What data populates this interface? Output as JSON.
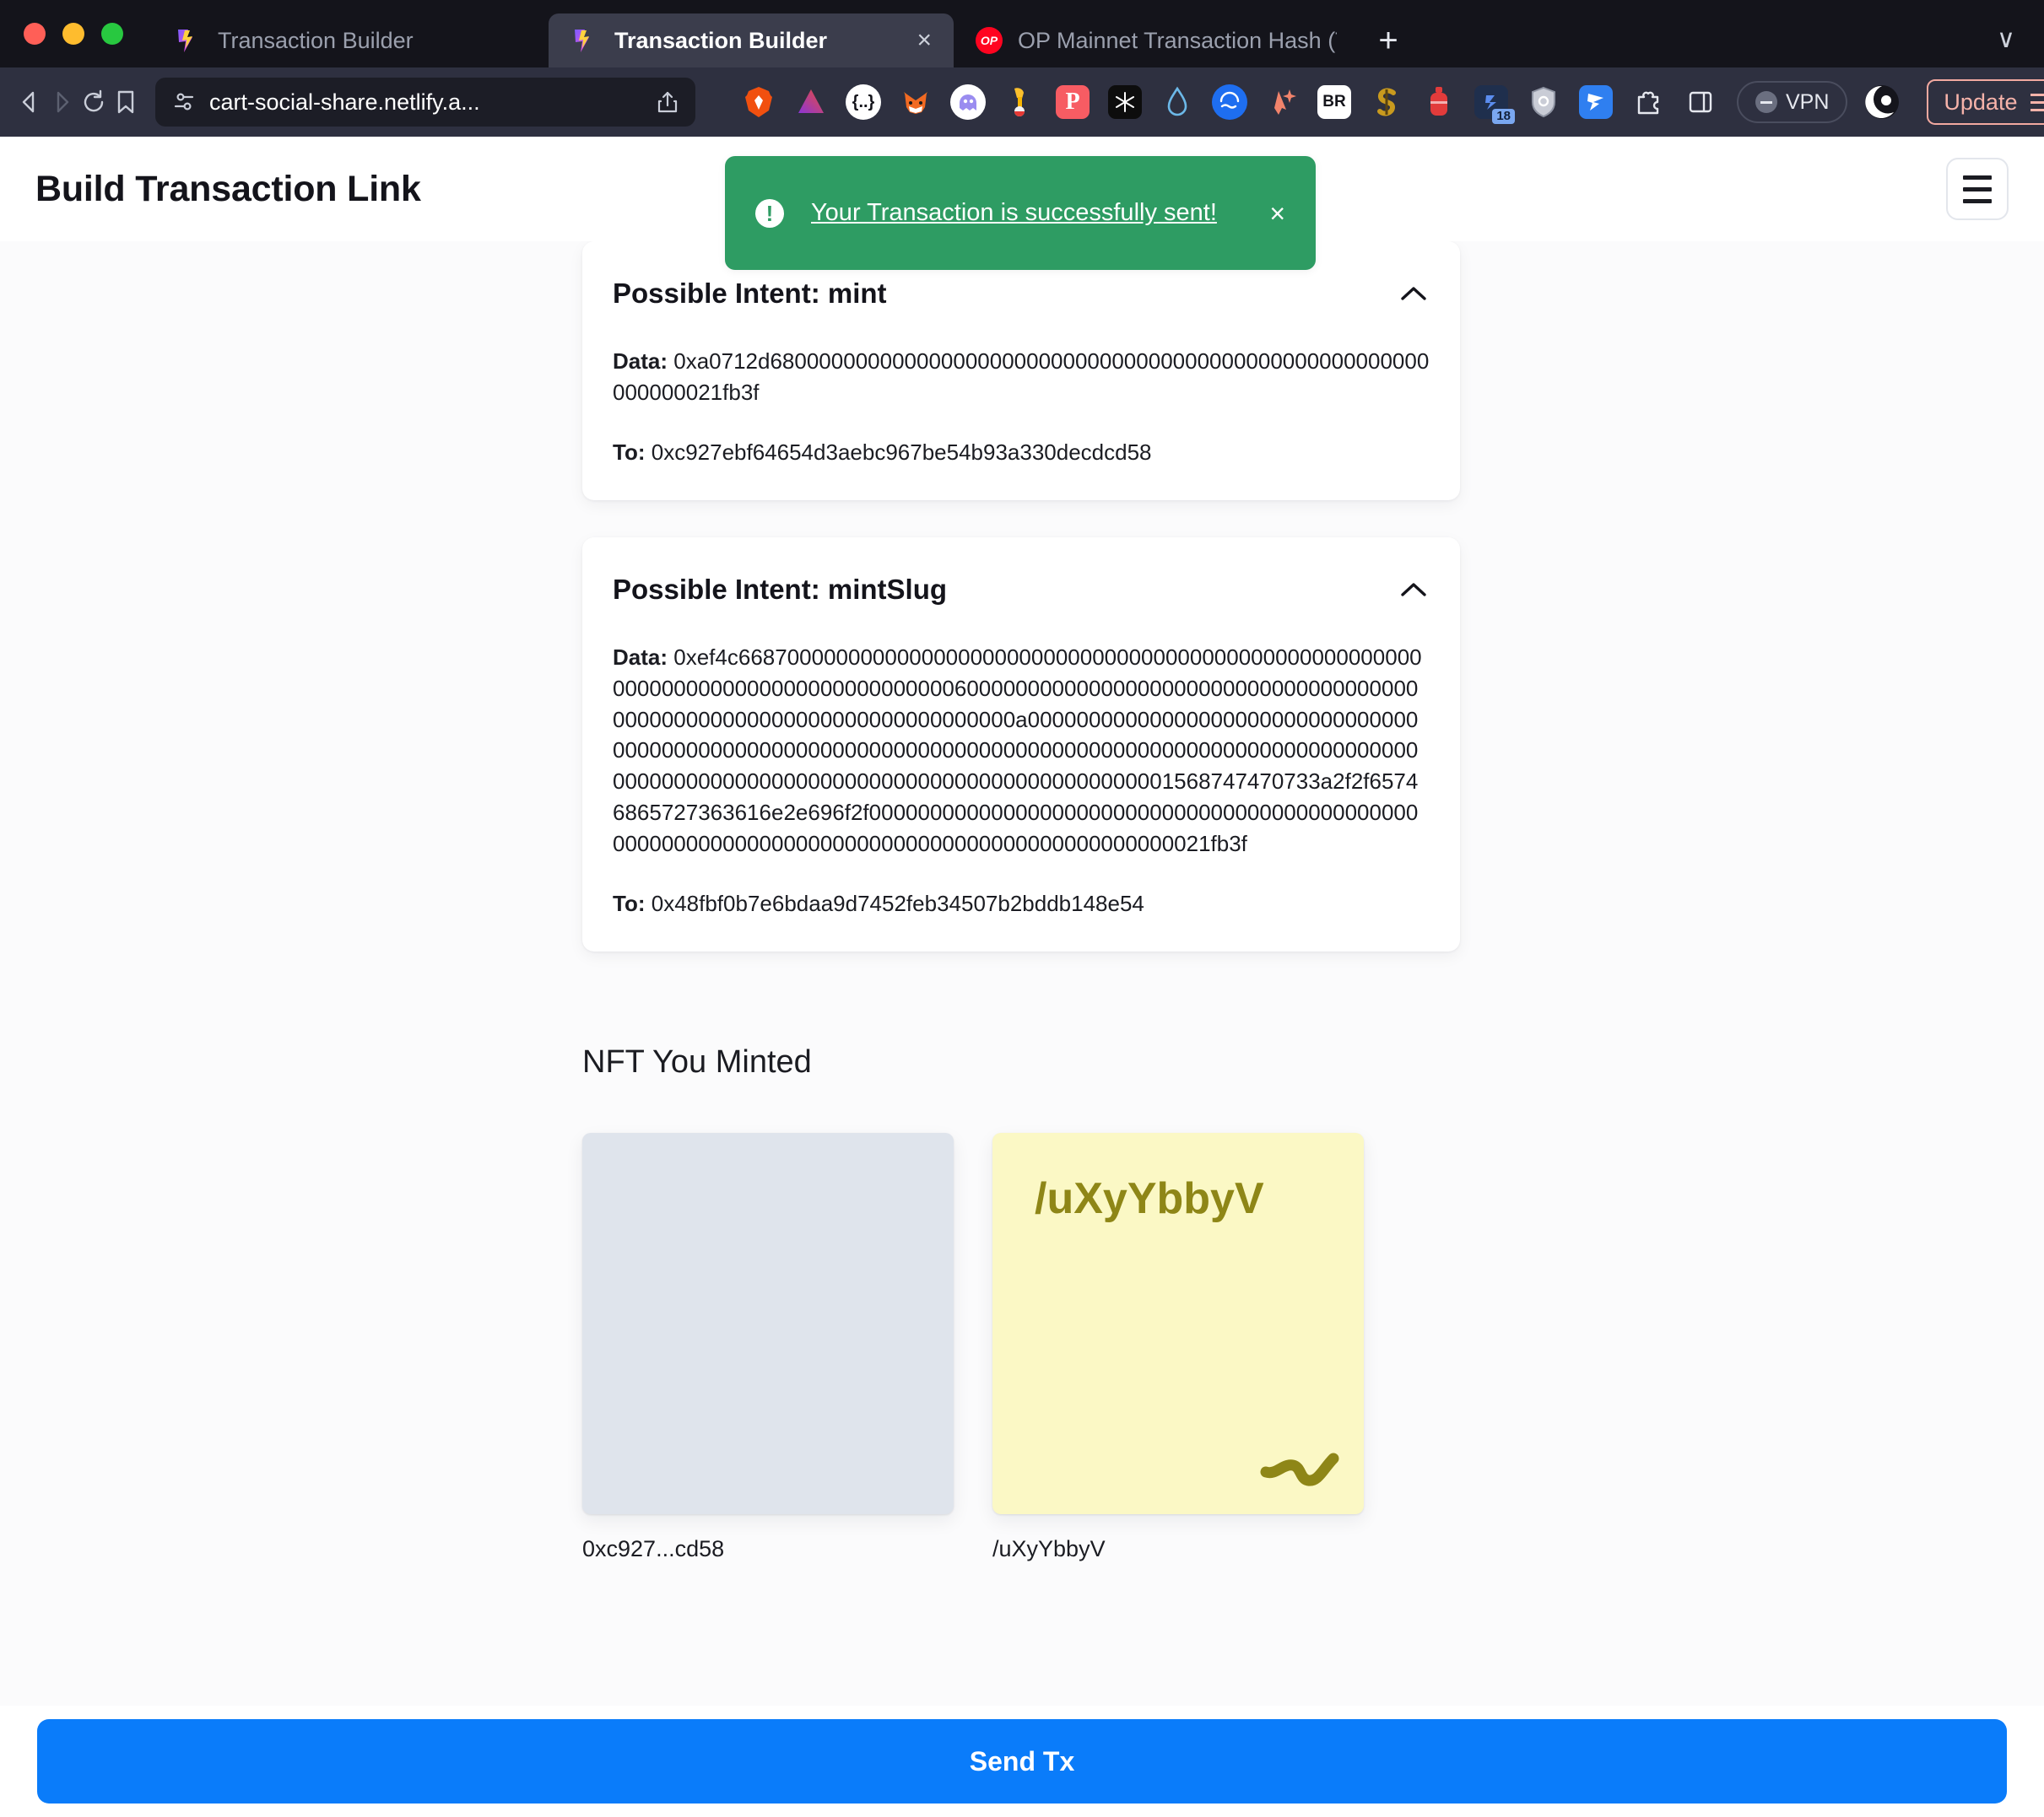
{
  "browser": {
    "tabs": [
      {
        "title": "Transaction Builder",
        "favicon": "lightning-icon",
        "active": false
      },
      {
        "title": "Transaction Builder",
        "favicon": "lightning-icon",
        "active": true,
        "close_label": "×"
      },
      {
        "title": "OP Mainnet Transaction Hash (Txha",
        "favicon": "op-icon",
        "active": false
      }
    ],
    "new_tab_label": "+",
    "tab_list_chevron": "∨",
    "toolbar": {
      "back_icon": "back-arrow-icon",
      "forward_icon": "forward-arrow-icon",
      "reload_icon": "reload-icon",
      "bookmark_icon": "bookmark-icon",
      "site_settings_icon": "site-settings-icon",
      "url": "cart-social-share.netlify.a...",
      "share_icon": "share-icon",
      "extensions": [
        "brave-icon",
        "a-triangle-icon",
        "braces-icon",
        "metamask-fox-icon",
        "phantom-ghost-icon",
        "rabby-icon",
        "phantom-p-icon",
        "snowflake-icon",
        "droplet-icon",
        "wave-icon",
        "origami-icon",
        "br-icon",
        "s-icon",
        "red-capsule-icon",
        "blue-app-icon",
        "shield-icon",
        "sparrow-icon",
        "puzzle-icon",
        "sidebar-icon"
      ],
      "extension_badge": "18",
      "vpn_label": "VPN",
      "leo_icon": "leo-icon",
      "update_label": "Update",
      "menu_icon": "hamburger-icon"
    }
  },
  "page": {
    "title": "Build Transaction Link",
    "menu_button_icon": "hamburger-menu-icon",
    "toast": {
      "icon": "exclamation-icon",
      "message": "Your Transaction is successfully sent!",
      "close_label": "×",
      "color": "#2e9c63"
    },
    "intents": [
      {
        "heading": "Possible Intent: mint",
        "collapse_icon": "chevron-up-icon",
        "data_label": "Data:",
        "data_value": "0xa0712d680000000000000000000000000000000000000000000000000000000000021fb3f",
        "to_label": "To:",
        "to_value": "0xc927ebf64654d3aebc967be54b93a330decdcd58"
      },
      {
        "heading": "Possible Intent: mintSlug",
        "collapse_icon": "chevron-up-icon",
        "data_label": "Data:",
        "data_value": "0xef4c66870000000000000000000000000000000000000000000000000000000000000000000000000000000060000000000000000000000000000000000000000000000000000000000000000000000a000000000000000000000000000000000000000000000000000000000000000000000000000000000000000000000000000000000000000000000000000000000000000000000001568747470733a2f2f65746865727363616e2e696f2f0000000000000000000000000000000000000000000000000000000000000000000000000000000000000000000021fb3f",
        "to_label": "To:",
        "to_value": "0x48fbf0b7e6bdaa9d7452feb34507b2bddb148e54"
      }
    ],
    "nft_section": {
      "heading": "NFT You Minted",
      "items": [
        {
          "caption": "0xc927...cd58",
          "art_label": "",
          "art_color": "#dfe4ec",
          "art_type": "blank"
        },
        {
          "caption": "/uXyYbbyV",
          "art_label": "/uXyYbbyV",
          "art_color": "#fbf8c5",
          "art_text_color": "#8e8617",
          "art_type": "slug"
        }
      ]
    },
    "send_button_label": "Send Tx",
    "accent_color": "#0a7cfa"
  }
}
